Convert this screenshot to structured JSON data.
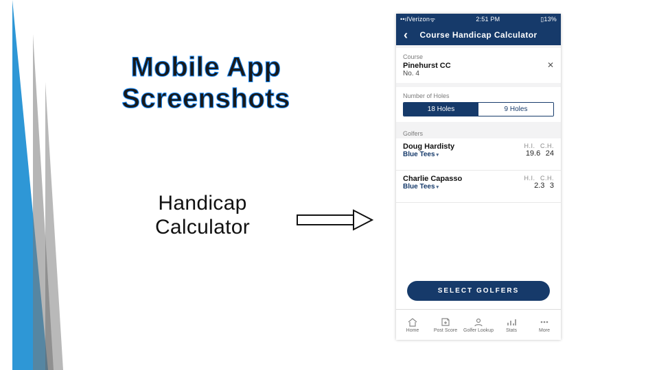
{
  "slide": {
    "title": "Mobile App Screenshots",
    "subtitle": "Handicap Calculator"
  },
  "phone": {
    "status": {
      "carrier": "Verizon",
      "time": "2:51 PM",
      "battery": "13%"
    },
    "nav": {
      "title": "Course Handicap Calculator",
      "back_glyph": "‹"
    },
    "course_section": {
      "label": "Course",
      "course_name": "Pinehurst CC",
      "course_tee": "No. 4",
      "clear_glyph": "✕"
    },
    "holes_section": {
      "label": "Number of Holes",
      "options": [
        "18 Holes",
        "9 Holes"
      ],
      "active_index": 0
    },
    "golfers_section": {
      "label": "Golfers",
      "header_hi": "H.I.",
      "header_ch": "C.H.",
      "golfers": [
        {
          "name": "Doug Hardisty",
          "tees": "Blue Tees",
          "hi": "19.6",
          "ch": "24"
        },
        {
          "name": "Charlie Capasso",
          "tees": "Blue Tees",
          "hi": "2.3",
          "ch": "3"
        }
      ]
    },
    "cta_label": "SELECT GOLFERS",
    "tabs": [
      {
        "name": "home",
        "label": "Home"
      },
      {
        "name": "post-score",
        "label": "Post Score"
      },
      {
        "name": "golfer-lookup",
        "label": "Golfer Lookup"
      },
      {
        "name": "stats",
        "label": "Stats"
      },
      {
        "name": "more",
        "label": "More"
      }
    ]
  }
}
